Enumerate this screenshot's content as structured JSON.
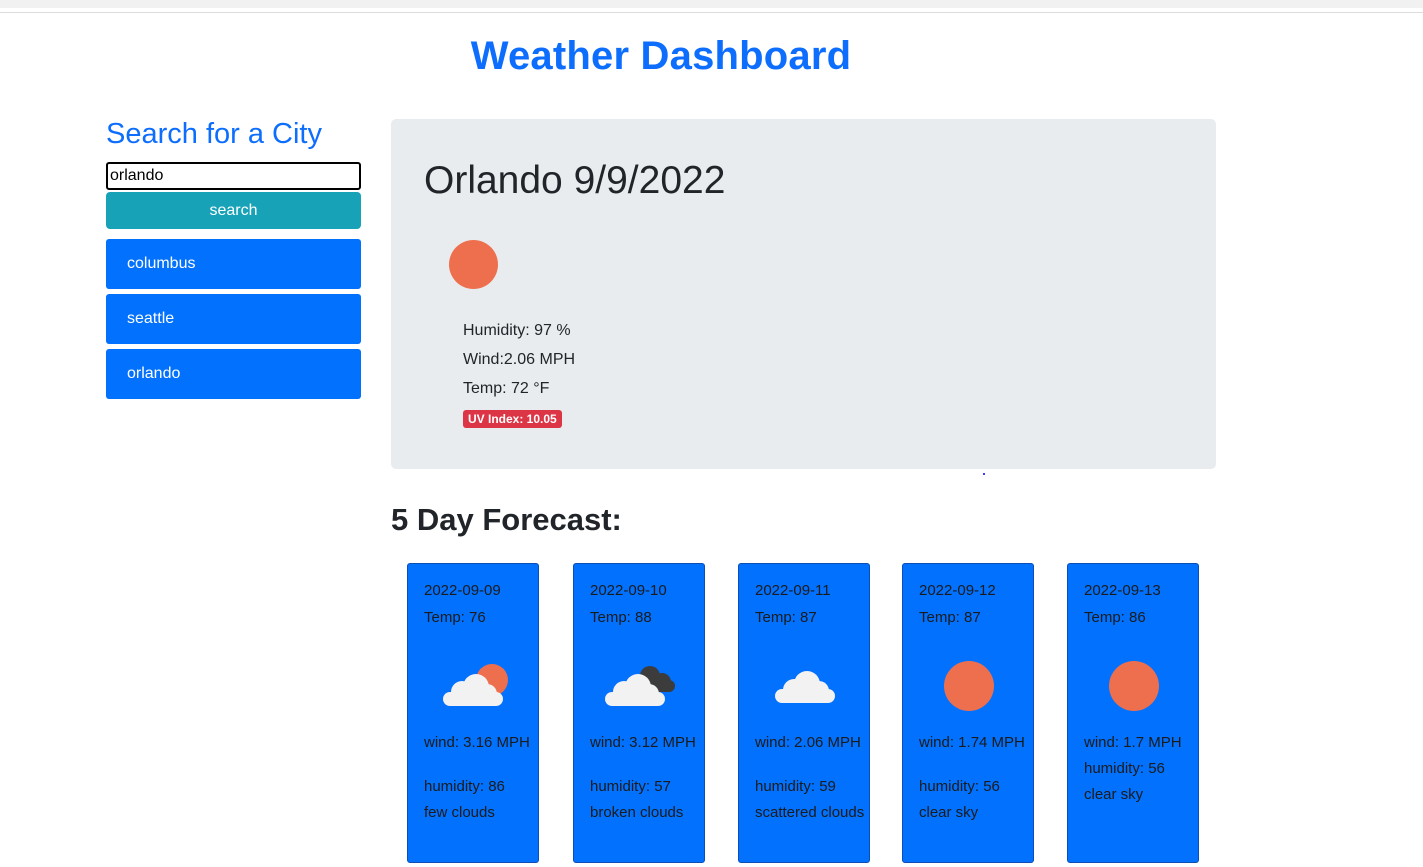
{
  "header": {
    "title": "Weather Dashboard"
  },
  "sidebar": {
    "heading": "Search for a City",
    "search_value": "orlando",
    "search_button_label": "search",
    "history": [
      "columbus",
      "seattle",
      "orlando"
    ]
  },
  "current": {
    "title": "Orlando 9/9/2022",
    "icon": "sun-icon",
    "humidity": "Humidity: 97 %",
    "wind": "Wind:2.06 MPH",
    "temp": "Temp: 72 °F",
    "uv": "UV Index: 10.05",
    "uv_color": "#dc3545"
  },
  "forecast": {
    "heading": "5 Day Forecast:",
    "days": [
      {
        "date": "2022-09-09",
        "temp": "Temp: 76",
        "icon": "few-clouds-icon",
        "wind": "wind: 3.16 MPH",
        "humidity": "humidity: 86",
        "description": "few clouds"
      },
      {
        "date": "2022-09-10",
        "temp": "Temp: 88",
        "icon": "broken-clouds-icon",
        "wind": "wind: 3.12 MPH",
        "humidity": "humidity: 57",
        "description": "broken clouds"
      },
      {
        "date": "2022-09-11",
        "temp": "Temp: 87",
        "icon": "scattered-clouds-icon",
        "wind": "wind: 2.06 MPH",
        "humidity": "humidity: 59",
        "description": "scattered clouds"
      },
      {
        "date": "2022-09-12",
        "temp": "Temp: 87",
        "icon": "sun-icon",
        "wind": "wind: 1.74 MPH",
        "humidity": "humidity: 56",
        "description": "clear sky"
      },
      {
        "date": "2022-09-13",
        "temp": "Temp: 86",
        "icon": "sun-icon",
        "wind": "wind: 1.7 MPH",
        "humidity": "humidity: 56",
        "description": "clear sky"
      }
    ]
  },
  "colors": {
    "accent": "#0d6efd",
    "search_button": "#17a2b8",
    "history_button": "#0171fe",
    "current_card_bg": "#e9ecef",
    "sun": "#ee6f4d"
  }
}
